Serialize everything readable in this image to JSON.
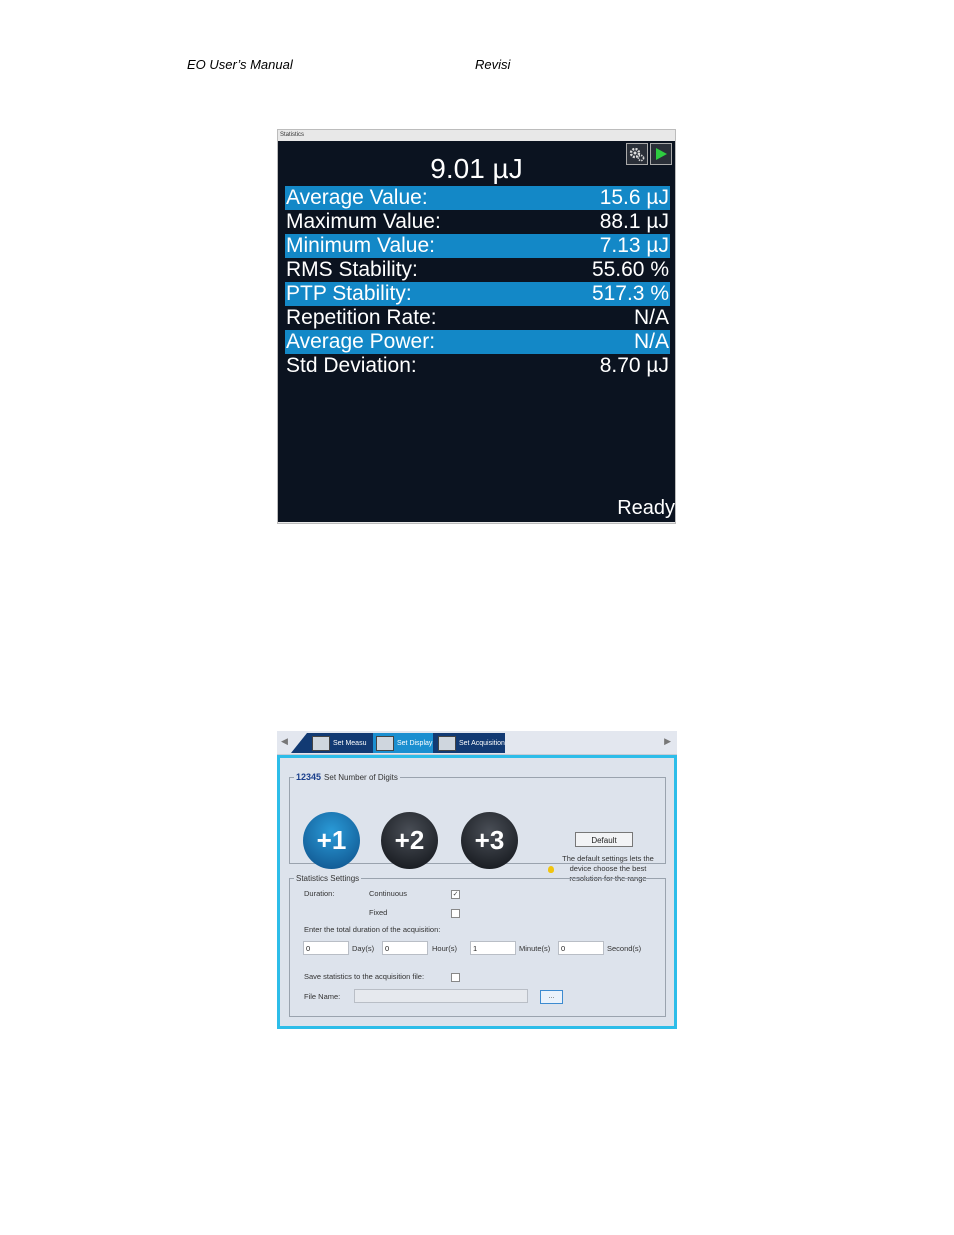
{
  "header": {
    "left": "EO User’s Manual",
    "right": "Revisi"
  },
  "stats_panel": {
    "title": "Statistics",
    "main_value": "9.01 µJ",
    "rows": [
      {
        "label": "Average Value:",
        "value": "15.6 µJ"
      },
      {
        "label": "Maximum Value:",
        "value": "88.1 µJ"
      },
      {
        "label": "Minimum Value:",
        "value": "7.13 µJ"
      },
      {
        "label": "RMS Stability:",
        "value": "55.60 %"
      },
      {
        "label": "PTP Stability:",
        "value": "517.3 %"
      },
      {
        "label": "Repetition Rate:",
        "value": "N/A"
      },
      {
        "label": "Average Power:",
        "value": "N/A"
      },
      {
        "label": "Std Deviation:",
        "value": "8.70 µJ"
      }
    ],
    "status": "Ready"
  },
  "settings_panel": {
    "tabs": [
      {
        "label": "Set Measu"
      },
      {
        "label": "Set Display"
      },
      {
        "label": "Set Acquisition"
      }
    ],
    "digits": {
      "legend": "Set Number of Digits",
      "buttons": [
        "+1",
        "+2",
        "+3"
      ],
      "default_label": "Default",
      "note": "The default settings lets the device choose the best resolution for the range"
    },
    "statistics": {
      "legend": "Statistics Settings",
      "duration_label": "Duration:",
      "continuous_label": "Continuous",
      "continuous_checked": true,
      "fixed_label": "Fixed",
      "fixed_checked": false,
      "enter_label": "Enter the total duration of the acquisition:",
      "days_value": "0",
      "days_label": "Day(s)",
      "hours_value": "0",
      "hours_label": "Hour(s)",
      "minutes_value": "1",
      "minutes_label": "Minute(s)",
      "seconds_value": "0",
      "seconds_label": "Second(s)",
      "save_label": "Save statistics to the acquisition file:",
      "save_checked": false,
      "file_label": "File Name:",
      "file_value": "",
      "browse_label": "..."
    }
  }
}
